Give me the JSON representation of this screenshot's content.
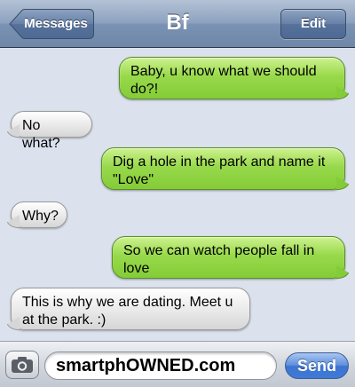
{
  "nav": {
    "back_label": "Messages",
    "title": "Bf",
    "edit_label": "Edit"
  },
  "messages": [
    {
      "direction": "sent",
      "text": "Baby, u know what we should do?!"
    },
    {
      "direction": "received",
      "text": "No what?"
    },
    {
      "direction": "sent",
      "text": "Dig a hole in the park and name it \"Love\""
    },
    {
      "direction": "received",
      "text": "Why?"
    },
    {
      "direction": "sent",
      "text": "So we can watch people fall in love"
    },
    {
      "direction": "received",
      "text": "This is why we are dating. Meet u at the park. :)"
    }
  ],
  "input": {
    "value": "smartphOWNED.com",
    "send_label": "Send",
    "camera_icon": "camera-icon"
  },
  "colors": {
    "sent_bubble": "#8ed246",
    "received_bubble": "#e5e5e5",
    "nav_bar": "#7f95b5",
    "send_button": "#4a7fd6"
  }
}
